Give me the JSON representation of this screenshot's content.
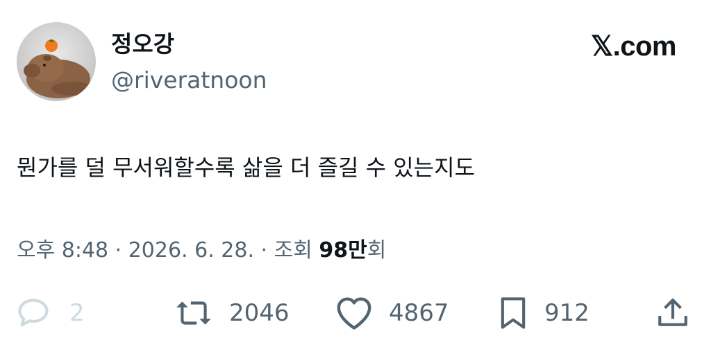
{
  "author": {
    "display_name": "정오강",
    "handle": "@riveratnoon",
    "avatar": "capybara-avatar"
  },
  "brand": {
    "text": "𝕏.com",
    "icon": "x-logo"
  },
  "tweet": {
    "text": "뭔가를 덜 무서워할수록 삶을 더 즐길 수 있는지도"
  },
  "meta": {
    "timestamp": "오후 8:48 · 2026. 6. 28. · 조회",
    "views_count": "98만",
    "views_suffix": "회"
  },
  "actions": {
    "replies": "2",
    "retweets": "2046",
    "likes": "4867",
    "bookmarks": "912"
  },
  "colors": {
    "text": "#0f1419",
    "secondary": "#536471",
    "muted": "#cfd9de",
    "background": "#ffffff"
  }
}
